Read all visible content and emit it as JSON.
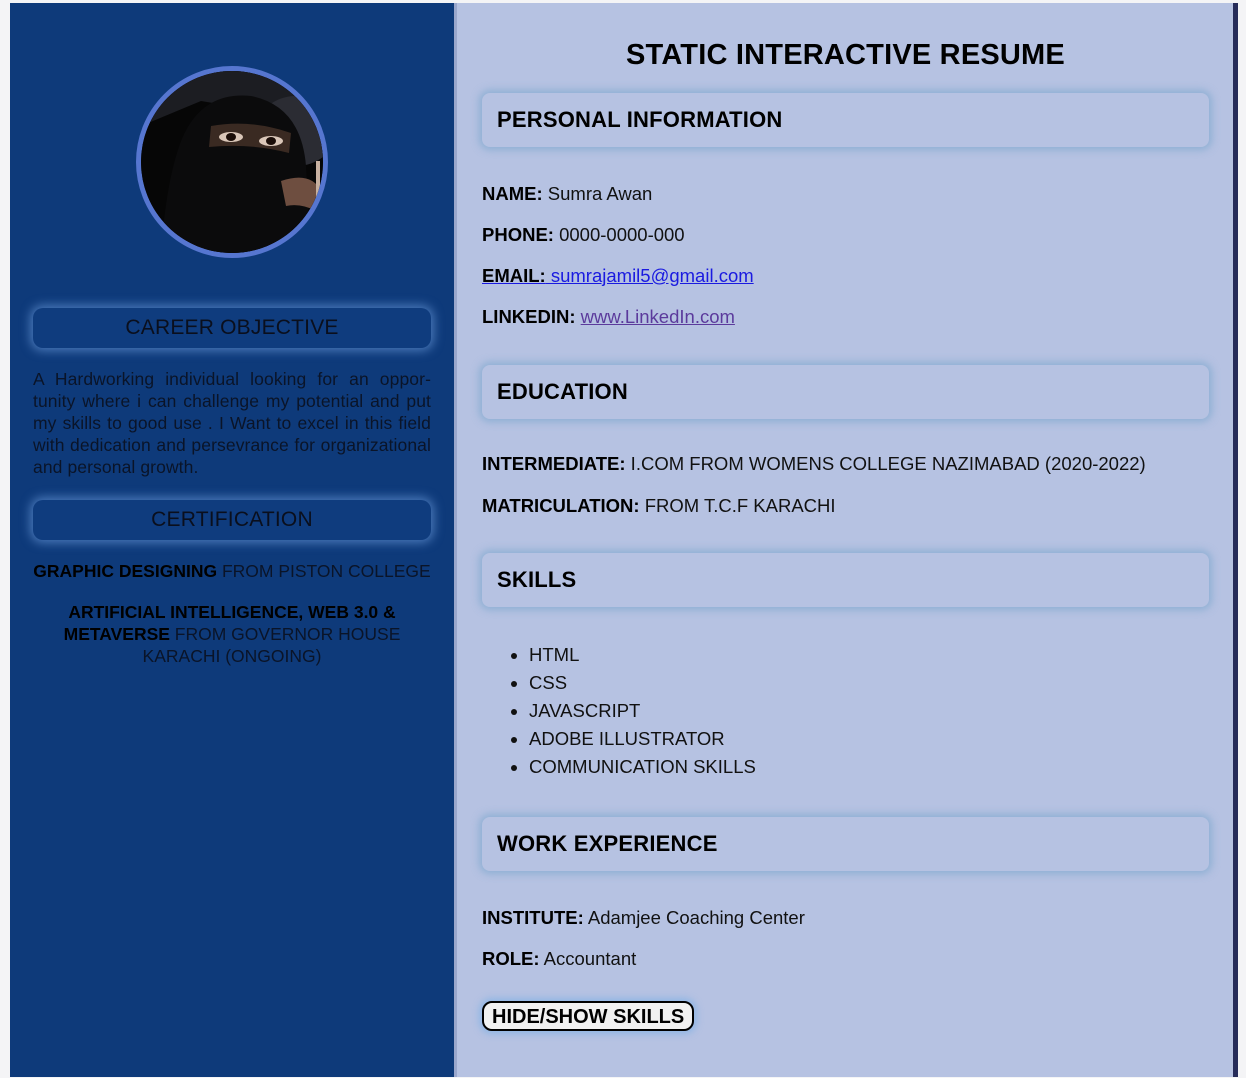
{
  "page_title": "STATIC INTERACTIVE RESUME",
  "sidebar": {
    "career_objective": {
      "heading": "CAREER OBJECTIVE",
      "text": "A Hardworking individual looking for an oppor-tunity where i can challenge my potential and put my skills to good use . I Want to excel in this field with dedication and persevrance for organizational and personal growth."
    },
    "certification": {
      "heading": "CERTIFICATION",
      "items": [
        {
          "title": "GRAPHIC DESIGNING",
          "detail": " FROM PISTON COLLEGE"
        },
        {
          "title": "ARTIFICIAL INTELLIGENCE, WEB 3.0 & METAVERSE",
          "detail": " FROM GOVERNOR HOUSE KARACHI (ONGOING)"
        }
      ]
    }
  },
  "personal_information": {
    "heading": "PERSONAL INFORMATION",
    "name": {
      "label": "NAME:",
      "value": " Sumra Awan"
    },
    "phone": {
      "label": "PHONE:",
      "value": " 0000-0000-000"
    },
    "email": {
      "label": "EMAIL:",
      "value": " sumrajamil5@gmail.com"
    },
    "linkedin": {
      "label": "LINKEDIN:",
      "value": "www.LinkedIn.com"
    }
  },
  "education": {
    "heading": "EDUCATION",
    "intermediate": {
      "label": "INTERMEDIATE:",
      "value": " I.COM FROM WOMENS COLLEGE NAZIMABAD (2020-2022)"
    },
    "matriculation": {
      "label": "MATRICULATION:",
      "value": " FROM T.C.F KARACHI"
    }
  },
  "skills": {
    "heading": "SKILLS",
    "items": [
      "HTML",
      "CSS",
      "JAVASCRIPT",
      "ADOBE ILLUSTRATOR",
      "COMMUNICATION SKILLS"
    ]
  },
  "work_experience": {
    "heading": "WORK EXPERIENCE",
    "institute": {
      "label": "INSTITUTE:",
      "value": " Adamjee Coaching Center"
    },
    "role": {
      "label": "ROLE:",
      "value": " Accountant"
    }
  },
  "toggle_button_label": "HIDE/SHOW SKILLS",
  "colors": {
    "sidebar_bg": "#0e3a7a",
    "main_bg": "#b6c2e2",
    "avatar_border": "#5676d0",
    "link": "#1a1ae0",
    "visited_link": "#5b3a9c"
  }
}
